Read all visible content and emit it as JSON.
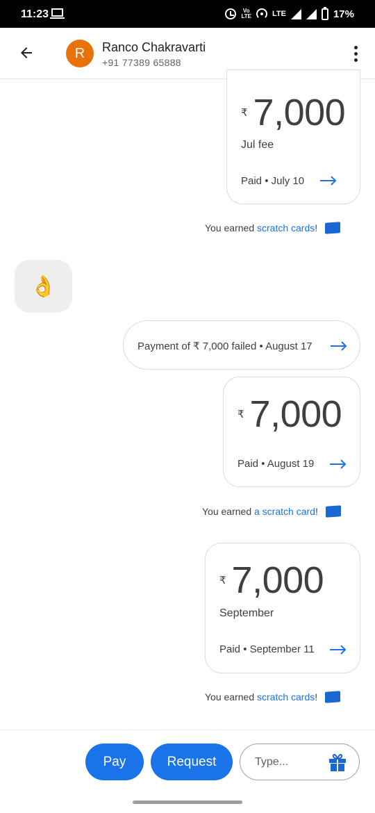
{
  "status_bar": {
    "time": "11:23",
    "volte": [
      "Vo",
      "LTE"
    ],
    "lte": "LTE",
    "battery": "17%"
  },
  "header": {
    "avatar_letter": "R",
    "name": "Ranco Chakravarti",
    "phone": "+91 77389 65888"
  },
  "messages": {
    "jul": {
      "currency": "₹",
      "amount": "7,000",
      "note": "Jul fee",
      "status": "Paid • July 10"
    },
    "reward1": {
      "prefix": "You earned ",
      "link": "scratch cards",
      "suffix": "!"
    },
    "emoji": "👌",
    "failed": {
      "text": "Payment of ₹ 7,000 failed • August 17"
    },
    "aug": {
      "currency": "₹",
      "amount": "7,000",
      "status": "Paid • August 19"
    },
    "reward2": {
      "prefix": "You earned ",
      "link": "a scratch card",
      "suffix": "!"
    },
    "sep": {
      "currency": "₹",
      "amount": "7,000",
      "note": "September",
      "status": "Paid • September 11"
    },
    "reward3": {
      "prefix": "You earned ",
      "link": "scratch cards",
      "suffix": "!"
    }
  },
  "composer": {
    "pay_label": "Pay",
    "request_label": "Request",
    "placeholder": "Type..."
  },
  "colors": {
    "accent": "#1a73e8",
    "avatar": "#e8710a",
    "scratch_card": "#1967d2"
  }
}
